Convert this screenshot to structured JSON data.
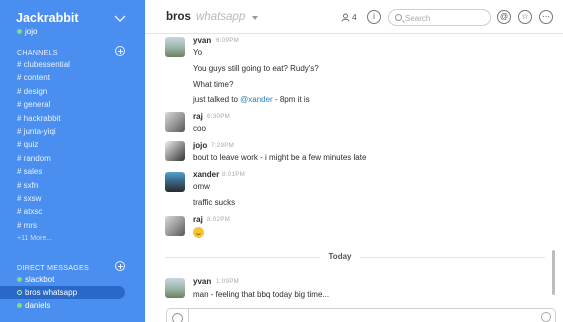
{
  "sidebar": {
    "team_name": "Jackrabbit",
    "user": "jojo",
    "channels_title": "CHANNELS",
    "channels": [
      "# clubessential",
      "# content",
      "# design",
      "# general",
      "# hackrabbit",
      "# junta-yiqi",
      "# quiz",
      "# random",
      "# sales",
      "# sxfn",
      "# sxsw",
      "# atxsc",
      "# mrs"
    ],
    "more_label": "+11 More...",
    "dm_title": "DIRECT MESSAGES",
    "dms": [
      {
        "label": "slackbot",
        "status": "online"
      },
      {
        "label": "bros whatsapp",
        "status": "away"
      },
      {
        "label": "daniels",
        "status": "online"
      }
    ]
  },
  "header": {
    "channel": "bros",
    "purpose": "whatsapp",
    "member_count": "4",
    "search_placeholder": "Search"
  },
  "messages": [
    {
      "author": "yvan",
      "time": "6:09PM",
      "lines": [
        "Yo",
        "You guys still going to eat? Rudy's?",
        "What time?"
      ]
    },
    {
      "line_prefix": "just talked to ",
      "mention": "@xander",
      "line_suffix": " - 8pm it is"
    },
    {
      "author": "raj",
      "time": "6:30PM",
      "lines": [
        "coo"
      ]
    },
    {
      "author": "jojo",
      "time": "7:29PM",
      "lines": [
        "bout to leave work - i might be a few minutes late"
      ]
    },
    {
      "author": "xander",
      "time": "8:01PM",
      "lines": [
        "omw",
        "traffic sucks"
      ]
    },
    {
      "author": "raj",
      "time": "8:02PM"
    },
    {
      "author": "yvan",
      "time": "1:09PM",
      "lines": [
        "man - feeling that bbq today big time..."
      ]
    }
  ],
  "divider": "Today",
  "colors": {
    "sidebar": "#4a8ef0",
    "active_dm": "#2a68c8",
    "mention": "#2a80b9"
  }
}
